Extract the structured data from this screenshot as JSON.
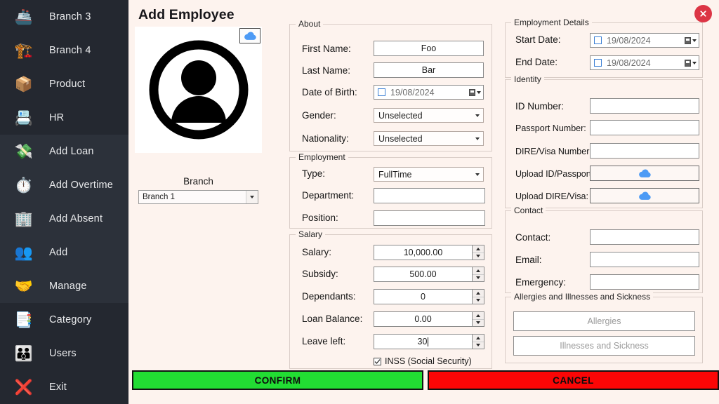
{
  "sidebar": {
    "items": [
      {
        "label": "Branch 3",
        "icon": "branch-ship-icon",
        "glyph": "🚢",
        "selected": false
      },
      {
        "label": "Branch 4",
        "icon": "branch-crane-icon",
        "glyph": "🏗️",
        "selected": false
      },
      {
        "label": "Product",
        "icon": "product-boxes-icon",
        "glyph": "📦",
        "selected": false
      },
      {
        "label": "HR",
        "icon": "hr-desk-icon",
        "glyph": "📇",
        "selected": false
      },
      {
        "label": "Add Loan",
        "icon": "loan-nodes-icon",
        "glyph": "💸",
        "selected": true
      },
      {
        "label": "Add Overtime",
        "icon": "clock-icon",
        "glyph": "⏱️",
        "selected": true
      },
      {
        "label": "Add Absent",
        "icon": "absent-icon",
        "glyph": "🏢",
        "selected": true
      },
      {
        "label": "Add",
        "icon": "add-person-icon",
        "glyph": "👥",
        "selected": true
      },
      {
        "label": "Manage",
        "icon": "manage-people-icon",
        "glyph": "🤝",
        "selected": true
      },
      {
        "label": "Category",
        "icon": "list-icon",
        "glyph": "📑",
        "selected": false
      },
      {
        "label": "Users",
        "icon": "users-icon",
        "glyph": "👪",
        "selected": false
      },
      {
        "label": "Exit",
        "icon": "exit-icon",
        "glyph": "❌",
        "selected": false
      }
    ]
  },
  "header": {
    "title": "Add Employee",
    "close_icon": "close-icon"
  },
  "photo": {
    "avatar_icon": "person-avatar-icon",
    "upload_icon": "cloud-upload-icon"
  },
  "branch": {
    "label": "Branch",
    "value": "Branch 1",
    "options": [
      "Branch 1"
    ]
  },
  "about": {
    "title": "About",
    "first_name": {
      "label": "First Name:",
      "value": "Foo"
    },
    "last_name": {
      "label": "Last Name:",
      "value": "Bar"
    },
    "dob": {
      "label": "Date of Birth:",
      "value": "19/08/2024",
      "checked": false
    },
    "gender": {
      "label": "Gender:",
      "value": "Unselected"
    },
    "nationality": {
      "label": "Nationality:",
      "value": "Unselected"
    }
  },
  "employment": {
    "title": "Employment",
    "type": {
      "label": "Type:",
      "value": "FullTime"
    },
    "department": {
      "label": "Department:",
      "value": ""
    },
    "position": {
      "label": "Position:",
      "value": ""
    }
  },
  "salary": {
    "title": "Salary",
    "salary": {
      "label": "Salary:",
      "value": "10,000.00"
    },
    "subsidy": {
      "label": "Subsidy:",
      "value": "500.00"
    },
    "dependants": {
      "label": "Dependants:",
      "value": "0"
    },
    "loan_balance": {
      "label": "Loan Balance:",
      "value": "0.00"
    },
    "leave_left": {
      "label": "Leave left:",
      "value": "30"
    },
    "inss": {
      "label": "INSS (Social Security)",
      "checked": true
    }
  },
  "employment_details": {
    "title": "Employment Details",
    "start_date": {
      "label": "Start Date:",
      "value": "19/08/2024",
      "checked": false
    },
    "end_date": {
      "label": "End Date:",
      "value": "19/08/2024",
      "checked": false
    }
  },
  "identity": {
    "title": "Identity",
    "id_number": {
      "label": "ID Number:",
      "value": ""
    },
    "passport_number": {
      "label": "Passport Number:",
      "value": ""
    },
    "dire_visa": {
      "label": "DIRE/Visa Number:",
      "value": ""
    },
    "upload_id": {
      "label": "Upload ID/Passport:",
      "icon": "cloud-upload-icon"
    },
    "upload_dire": {
      "label": "Upload DIRE/Visa:",
      "icon": "cloud-upload-icon"
    }
  },
  "contact": {
    "title": "Contact",
    "contact": {
      "label": "Contact:",
      "value": ""
    },
    "email": {
      "label": "Email:",
      "value": ""
    },
    "emergency": {
      "label": "Emergency:",
      "value": ""
    }
  },
  "health": {
    "title": "Allergies and Illnesses and Sickness",
    "allergies": {
      "placeholder": "Allergies",
      "value": ""
    },
    "illnesses": {
      "placeholder": "Illnesses and Sickness",
      "value": ""
    }
  },
  "footer": {
    "confirm": "CONFIRM",
    "cancel": "CANCEL"
  },
  "colors": {
    "sidebar_bg": "#242830",
    "sidebar_selected": "#2c313a",
    "page_bg": "#fdf3ee",
    "confirm_green": "#22dd33",
    "cancel_red": "#fb0606",
    "close_red": "#dc3545",
    "cloud_blue": "#4d9bf5"
  }
}
